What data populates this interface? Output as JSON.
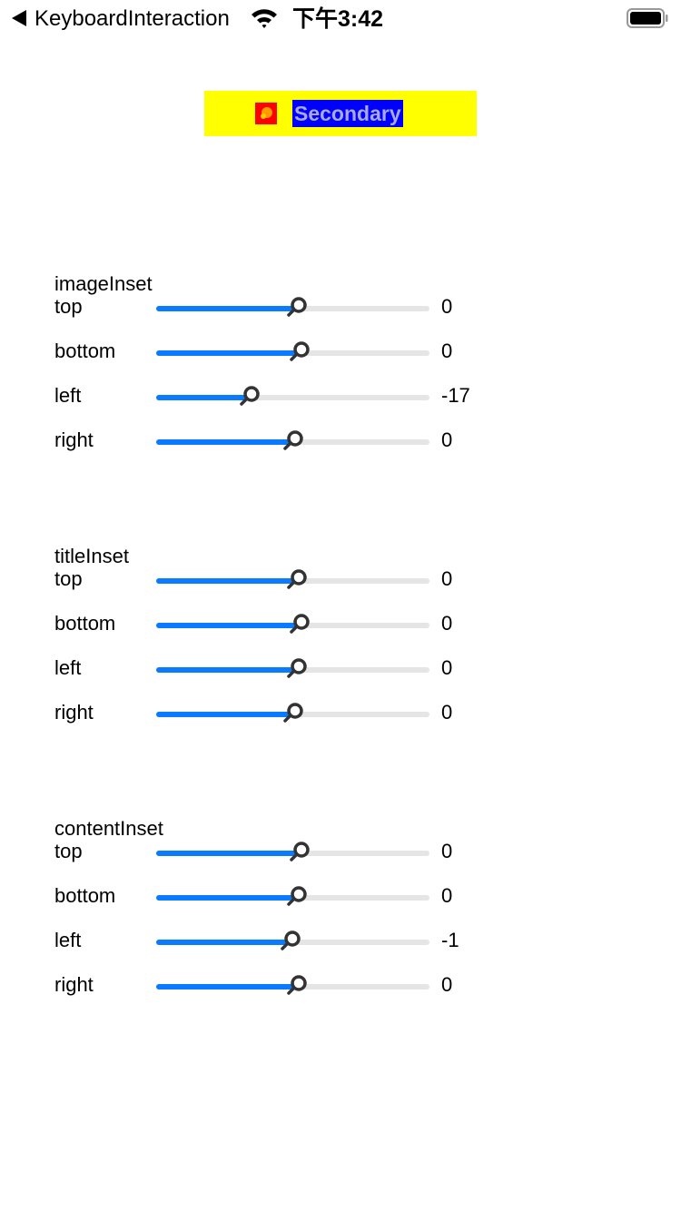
{
  "status_bar": {
    "back_label": "KeyboardInteraction",
    "time": "下午3:42"
  },
  "demo_button": {
    "title": "Secondary",
    "background_color": "#ffff00",
    "title_background_color": "#0000ff",
    "image_color": "#ff0000"
  },
  "slider_colors": {
    "fill": "#0a7aff",
    "track": "#e5e5e5",
    "thumb": "#333333"
  },
  "groups": [
    {
      "title": "imageInset",
      "rows": [
        {
          "label": "top",
          "value": "0",
          "level": 0.5
        },
        {
          "label": "bottom",
          "value": "0",
          "level": 0.51
        },
        {
          "label": "left",
          "value": "-17",
          "level": 0.33
        },
        {
          "label": "right",
          "value": "0",
          "level": 0.49
        }
      ]
    },
    {
      "title": "titleInset",
      "rows": [
        {
          "label": "top",
          "value": "0",
          "level": 0.5
        },
        {
          "label": "bottom",
          "value": "0",
          "level": 0.51
        },
        {
          "label": "left",
          "value": "0",
          "level": 0.5
        },
        {
          "label": "right",
          "value": "0",
          "level": 0.49
        }
      ]
    },
    {
      "title": "contentInset",
      "rows": [
        {
          "label": "top",
          "value": "0",
          "level": 0.51
        },
        {
          "label": "bottom",
          "value": "0",
          "level": 0.5
        },
        {
          "label": "left",
          "value": "-1",
          "level": 0.48
        },
        {
          "label": "right",
          "value": "0",
          "level": 0.5
        }
      ]
    }
  ]
}
